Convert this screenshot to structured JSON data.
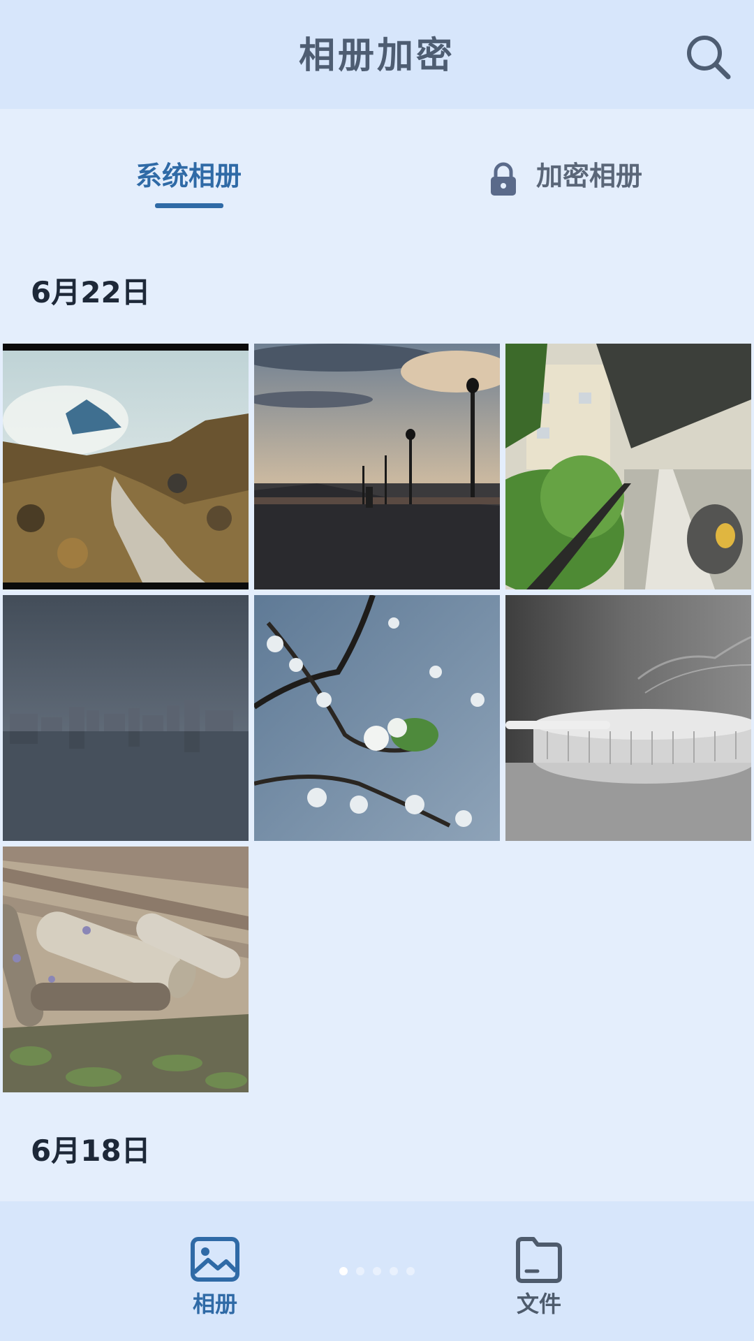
{
  "header": {
    "title": "相册加密",
    "search_icon": "search-icon"
  },
  "tabs": {
    "system_label": "系统相册",
    "encrypted_label": "加密相册",
    "active": "系统相册",
    "encrypted_icon": "lock-icon"
  },
  "sections": [
    {
      "date": "6月22日",
      "photo_count_visible": 7,
      "photos": [
        "rocky-stream-landscape",
        "riverside-walkway-sunset",
        "building-corridor-balcony",
        "city-skyline-over-water",
        "blossom-branch-sky",
        "glass-ashtray-smoke",
        "bamboo-logs-pile"
      ]
    },
    {
      "date": "6月18日"
    }
  ],
  "bottom_nav": {
    "items": [
      {
        "label": "相册",
        "icon": "image-icon",
        "active": true
      },
      {
        "label": "文件",
        "icon": "folder-icon",
        "active": false
      }
    ],
    "page_dots": 5,
    "active_dot": 1
  },
  "colors": {
    "background": "#e4eefc",
    "bar": "#d7e6fb",
    "accent": "#2f6aa6",
    "title": "#4e5d72",
    "text": "#1d2838"
  }
}
